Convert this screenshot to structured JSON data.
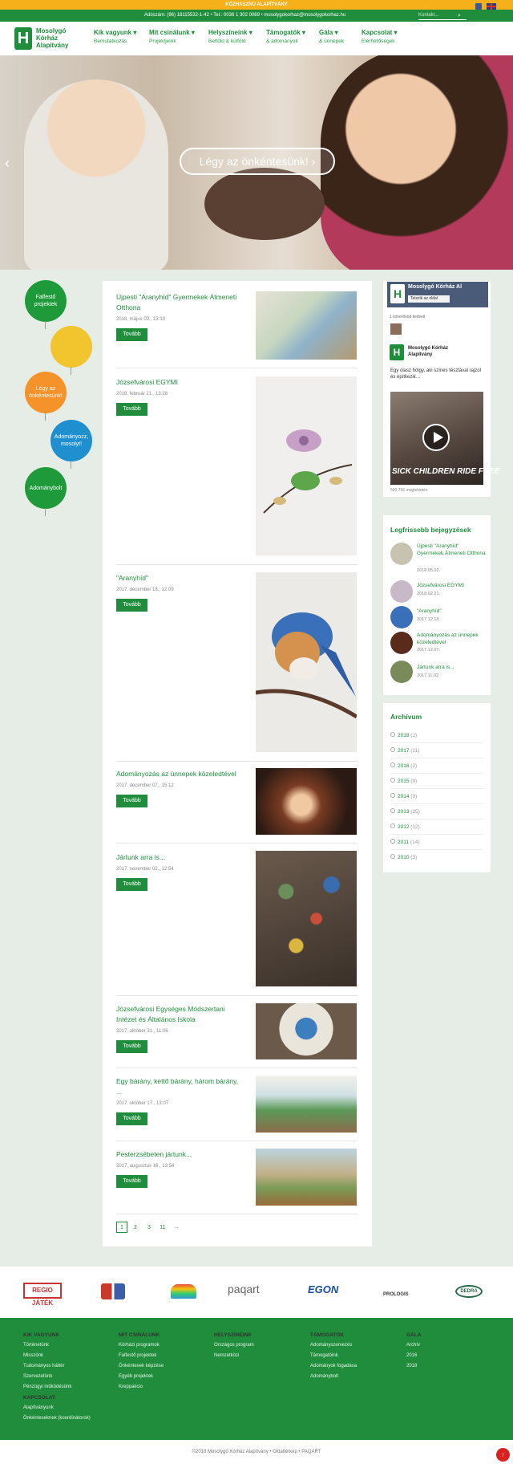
{
  "topbar": {
    "text": "KÖZHASZNÚ ALAPÍTVÁNY"
  },
  "contact": {
    "text": "Adószám: (96) 18115532-1-42 • Tel.: 0036 1 302 0069 • mosolygokorhaz@mosolygokorhaz.hu",
    "search_placeholder": "Kontakt...",
    "search_icon": "search-icon"
  },
  "logo": {
    "mark": "H",
    "line1": "Mosolygó",
    "line2": "Kórház",
    "line3": "Alapítvány"
  },
  "nav": [
    {
      "label": "Kik vagyunk ▾",
      "sub": "Bemutatkozás"
    },
    {
      "label": "Mit csinálunk ▾",
      "sub": "Projektjeink"
    },
    {
      "label": "Helyszíneink ▾",
      "sub": "Belföld & külföld"
    },
    {
      "label": "Támogatók ▾",
      "sub": "& adományok"
    },
    {
      "label": "Gála ▾",
      "sub": "& ünnepek"
    },
    {
      "label": "Kapcsolat ▾",
      "sub": "Elérhetőségek"
    }
  ],
  "hero": {
    "button": "Légy az önkéntesünk! ›",
    "prev": "‹"
  },
  "balloons": [
    {
      "label": "Falfestő projektek",
      "color": "#1e9a3a"
    },
    {
      "label": "",
      "color": "#f2c52e"
    },
    {
      "label": "Légy az önkéntesünk!",
      "color": "#f5922a"
    },
    {
      "label": "Adományozz, mosolyt!",
      "color": "#1f8fd0"
    },
    {
      "label": "Adománybolt",
      "color": "#1e9a3a"
    }
  ],
  "posts": [
    {
      "title": "Újpesti \"Aranyhíd\" Gyermekek Átmeneti Otthona",
      "date": "2018. május 02., 13:10",
      "button": "Tovább"
    },
    {
      "title": "Józsefvárosi EGYMI",
      "date": "2018. február 21., 13:28",
      "button": "Tovább"
    },
    {
      "title": "\"Aranyhíd\"",
      "date": "2017. december 18., 12:09",
      "button": "Tovább"
    },
    {
      "title": "Adományozás az ünnepek közeledtével",
      "date": "2017. december 07., 15:12",
      "button": "Tovább"
    },
    {
      "title": "Jártunk arra is...",
      "date": "2017. november 02., 12:54",
      "button": "Tovább"
    },
    {
      "title": "Józsefvárosi Egységes Módszertani Intézet és Általános Iskola",
      "date": "2017. október 31., 11:06",
      "button": "Tovább"
    },
    {
      "title": "Egy bárány, kettő bárány, három bárány, ...",
      "date": "2017. október 17., 13:07",
      "button": "Tovább"
    },
    {
      "title": "Pesterzsébeten jártunk...",
      "date": "2017. augusztus 16., 13:54",
      "button": "Tovább"
    }
  ],
  "pagination": [
    "1",
    "2",
    "3",
    "11",
    "→"
  ],
  "facebook": {
    "page_name": "Mosolygó Kórház Al",
    "follow": "Tetszik az oldal",
    "likes": "1 ismerősöd kedveli",
    "post_name": "Mosolygó Kórház Alapítvány",
    "post_text": "Egy olasz hölgy, aki színes tésztával rajzol és építkezik…",
    "video_text": "SICK CHILDREN RIDE FREE",
    "views": "500 756 megtekintés"
  },
  "recent": {
    "title": "Legfrissebb bejegyzések",
    "items": [
      {
        "title": "Újpesti \"Aranyhíd\" Gyermekek Átmeneti Otthona",
        "date": "2018.05.02."
      },
      {
        "title": "Józsefvárosi EGYMI",
        "date": "2018.02.21."
      },
      {
        "title": "\"Aranyhíd\"",
        "date": "2017.12.18."
      },
      {
        "title": "Adományozás az ünnepek közeledtével",
        "date": "2017.12.07."
      },
      {
        "title": "Jártunk arra is...",
        "date": "2017.11.02."
      }
    ]
  },
  "archive": {
    "title": "Archívum",
    "items": [
      {
        "year": "2018",
        "count": "(2)"
      },
      {
        "year": "2017",
        "count": "(11)"
      },
      {
        "year": "2016",
        "count": "(2)"
      },
      {
        "year": "2015",
        "count": "(9)"
      },
      {
        "year": "2014",
        "count": "(9)"
      },
      {
        "year": "2013",
        "count": "(25)"
      },
      {
        "year": "2012",
        "count": "(12)"
      },
      {
        "year": "2011",
        "count": "(14)"
      },
      {
        "year": "2010",
        "count": "(3)"
      }
    ]
  },
  "sponsors": [
    "REGIO JÁTÉK",
    "",
    "",
    "paqart",
    "EGON",
    "PROLOGIS",
    "DEDRA"
  ],
  "footer": {
    "columns": [
      {
        "head": "KIK VAGYUNK",
        "links": [
          "Történetünk",
          "Misszónk",
          "Tudományos háttér",
          "Szervezetünk",
          "Pénzügyi működésünk"
        ],
        "head2": "KAPCSOLAT",
        "links2": [
          "Alapítványunk",
          "Önkénteseknek (koordinátorok)"
        ]
      },
      {
        "head": "MIT CSINÁLUNK",
        "links": [
          "Kórházi programok",
          "Falfestő projektek",
          "Önkéntesek képzése",
          "Egyéb projektek",
          "Kreppakcio"
        ]
      },
      {
        "head": "HELYSZÍNEINK",
        "links": [
          "Országos program",
          "Nemzetközi"
        ]
      },
      {
        "head": "TÁMOGATÓK",
        "links": [
          "Adományszervezés",
          "Támogatóink",
          "Adományok fogadása",
          "Adománybolt"
        ]
      },
      {
        "head": "GÁLA",
        "links": [
          "Archív",
          "2016",
          "2018"
        ]
      }
    ]
  },
  "bottom": {
    "text": "©2018 Mosolygó Kórház Alapítvány • Oldaltérkép • PAQART",
    "scrolltop": "↑"
  }
}
